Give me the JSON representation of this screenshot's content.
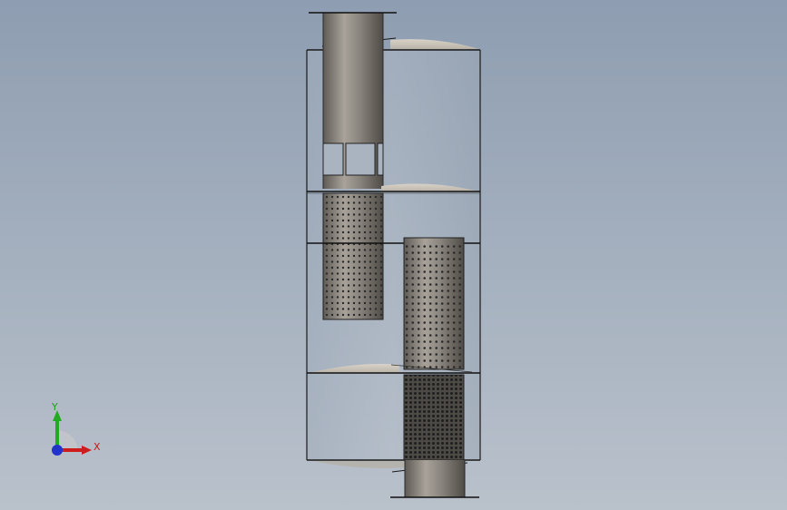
{
  "viewport": {
    "background_top": "#8e9db1",
    "background_bottom": "#b9c1cb",
    "model": "silencer-assembly-section-view"
  },
  "triad": {
    "y_label": "Y",
    "x_label": "X",
    "y_color": "#1e9e1e",
    "x_color": "#c21818",
    "z_color": "#2030c8"
  }
}
